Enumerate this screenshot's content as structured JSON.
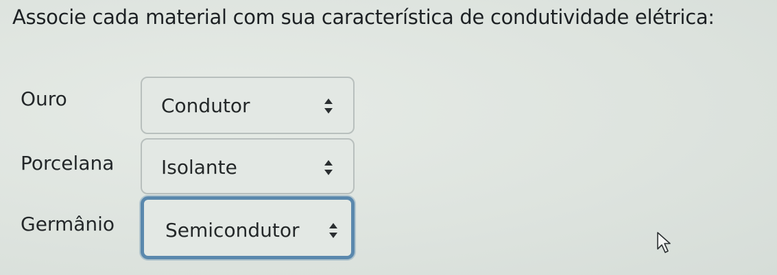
{
  "question": "Associe cada material com sua característica de condutividade elétrica:",
  "items": [
    {
      "material": "Ouro",
      "selected": "Condutor"
    },
    {
      "material": "Porcelana",
      "selected": "Isolante"
    },
    {
      "material": "Germânio",
      "selected": "Semicondutor"
    }
  ],
  "focus_color": "#5a88ad",
  "icons": {
    "select_caret": "up-down-caret-icon",
    "pointer": "mouse-pointer-icon"
  }
}
